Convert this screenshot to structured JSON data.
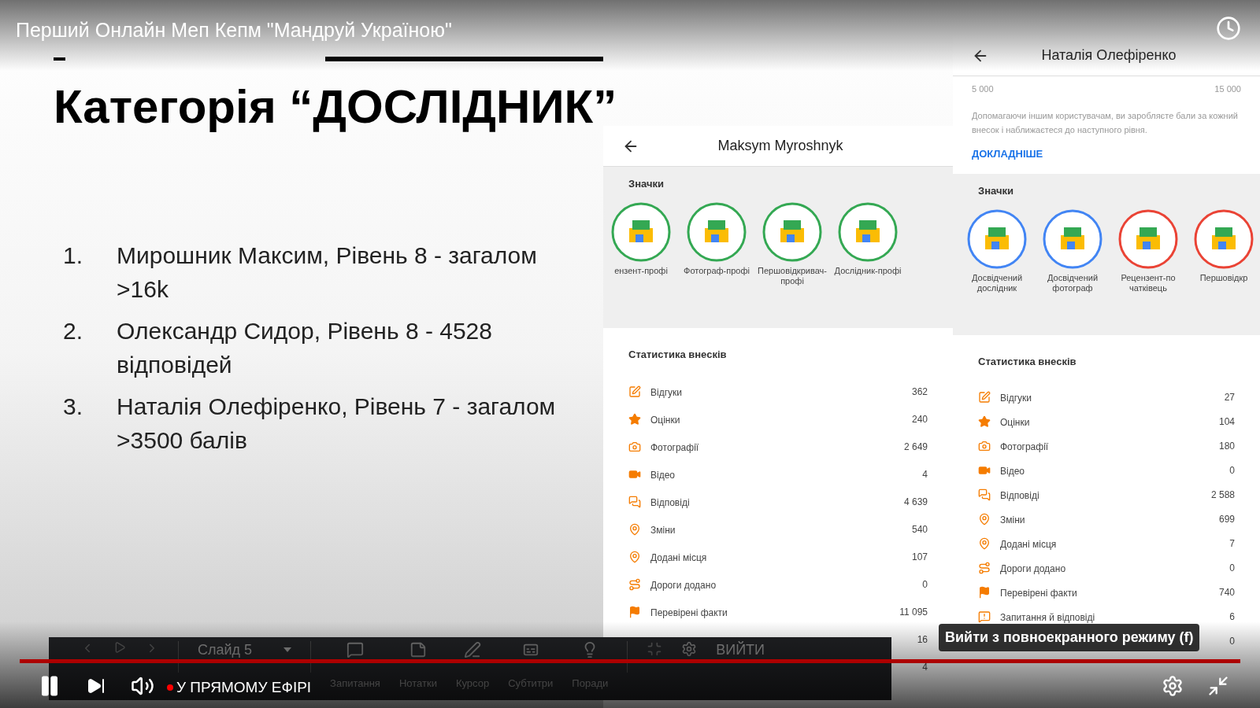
{
  "player": {
    "title": "Перший Онлайн Меп Кепм \"Мандруй Україною\"",
    "tooltip": "Вийти з повноекранного режиму (f)",
    "live_label": "У ПРЯМОМУ ЕФІРІ",
    "level": 1
  },
  "slide": {
    "heading": "Категорія “ДОСЛІДНИК”",
    "list": [
      {
        "number": "1.",
        "text": "Мирошник Максим, Рівень 8 - загалом >16k"
      },
      {
        "number": "2.",
        "text": "Олександр Сидор, Рівень 8 - 4528 відповідей"
      },
      {
        "number": "3.",
        "text": "Наталія Олефіренко, Рівень 7 - загалом >3500 балів"
      }
    ]
  },
  "profiles": [
    {
      "name": "Maksym Myroshnyk",
      "badges_title": "Значки",
      "badges": [
        {
          "label": "ензент-профі",
          "color": "#34a853"
        },
        {
          "label": "Фотограф-профі",
          "color": "#34a853"
        },
        {
          "label": "Першовідкривач-профі",
          "color": "#34a853"
        },
        {
          "label": "Дослідник-профі",
          "color": "#34a853"
        }
      ],
      "stats_title": "Статистика внесків",
      "stats": [
        {
          "kind": "review",
          "label": "Відгуки",
          "value": "362"
        },
        {
          "kind": "star",
          "label": "Оцінки",
          "value": "240"
        },
        {
          "kind": "photo",
          "label": "Фотографії",
          "value": "2 649"
        },
        {
          "kind": "video",
          "label": "Відео",
          "value": "4"
        },
        {
          "kind": "answers",
          "label": "Відповіді",
          "value": "4 639"
        },
        {
          "kind": "pin",
          "label": "Зміни",
          "value": "540"
        },
        {
          "kind": "pin",
          "label": "Додані місця",
          "value": "107"
        },
        {
          "kind": "road",
          "label": "Дороги додано",
          "value": "0"
        },
        {
          "kind": "flag",
          "label": "Перевірені факти",
          "value": "11 095"
        },
        {
          "kind": "hidden",
          "value": "16"
        },
        {
          "kind": "hidden",
          "value": "4"
        }
      ]
    },
    {
      "name": "Наталія Олефіренко",
      "range_start": "5 000",
      "range_end": "15 000",
      "description": "Допомагаючи іншим користувачам, ви заробляєте бали за кожний внесок і наближаєтеся до наступного рівня.",
      "link": "ДОКЛАДНІШЕ",
      "badges_title": "Значки",
      "badges": [
        {
          "label": "Досвідчений дослідник",
          "color": "#4285f4"
        },
        {
          "label": "Досвідчений фотограф",
          "color": "#4285f4"
        },
        {
          "label": "Рецензент-по чатківець",
          "color": "#ea4335"
        },
        {
          "label": "Першовідкр",
          "color": "#ea4335"
        }
      ],
      "stats_title": "Статистика внесків",
      "stats": [
        {
          "kind": "review",
          "label": "Відгуки",
          "value": "27"
        },
        {
          "kind": "star",
          "label": "Оцінки",
          "value": "104"
        },
        {
          "kind": "photo",
          "label": "Фотографії",
          "value": "180"
        },
        {
          "kind": "video",
          "label": "Відео",
          "value": "0"
        },
        {
          "kind": "answers",
          "label": "Відповіді",
          "value": "2 588"
        },
        {
          "kind": "pin",
          "label": "Зміни",
          "value": "699"
        },
        {
          "kind": "pin",
          "label": "Додані місця",
          "value": "7"
        },
        {
          "kind": "road",
          "label": "Дороги додано",
          "value": "0"
        },
        {
          "kind": "flag",
          "label": "Перевірені факти",
          "value": "740"
        },
        {
          "kind": "question",
          "label": "Запитання й відповіді",
          "value": "6"
        },
        {
          "kind": "hidden",
          "value": "0"
        }
      ]
    }
  ],
  "slides_toolbar": {
    "slide_label": "Слайд 5",
    "tools": [
      {
        "kind": "questions",
        "label": "Запитання"
      },
      {
        "kind": "notes",
        "label": "Нотатки"
      },
      {
        "kind": "pointer",
        "label": "Курсор"
      },
      {
        "kind": "captions",
        "label": "Субтитри"
      },
      {
        "kind": "tips",
        "label": "Поради"
      }
    ],
    "exit": "ВИЙТИ"
  }
}
